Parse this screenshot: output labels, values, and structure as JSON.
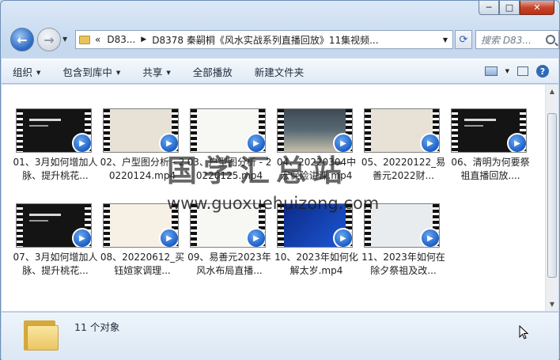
{
  "window": {
    "minimize": "─",
    "maximize": "□",
    "close": "✕"
  },
  "address": {
    "prefix": "«",
    "crumbs": [
      "D83...",
      "D8378 秦嗣桐《风水实战系列直播回放》11集视频..."
    ],
    "search_placeholder": "搜索 D83..."
  },
  "toolbar": {
    "organize": "组织",
    "include_library": "包含到库中",
    "share": "共享",
    "play_all": "全部播放",
    "new_folder": "新建文件夹"
  },
  "files": [
    {
      "name": "01、3月如何增加人脉、提升桃花...",
      "frame": "dark"
    },
    {
      "name": "02、户型图分析 - 20220124.mp4",
      "frame": "paper"
    },
    {
      "name": "03、户型图分析 - 20220125.mp4",
      "frame": "white"
    },
    {
      "name": "04、20220304中宏保险讲课.mp4",
      "frame": "room"
    },
    {
      "name": "05、20220122_易善元2022财...",
      "frame": "paper"
    },
    {
      "name": "06、清明为何要祭祖直播回放....",
      "frame": "dark"
    },
    {
      "name": "07、3月如何增加人脉、提升桃花...",
      "frame": "dark"
    },
    {
      "name": "08、20220612_买钰媗家调理...",
      "frame": "cream"
    },
    {
      "name": "09、易善元2023年风水布局直播...",
      "frame": "white"
    },
    {
      "name": "10、2023年如何化解太岁.mp4",
      "frame": "blue"
    },
    {
      "name": "11、2023年如何在除夕祭祖及改...",
      "frame": "person"
    }
  ],
  "watermark": {
    "title": "国学汇总站",
    "url": "www.guoxuehuizong.com"
  },
  "details": {
    "count": "11 个对象"
  }
}
